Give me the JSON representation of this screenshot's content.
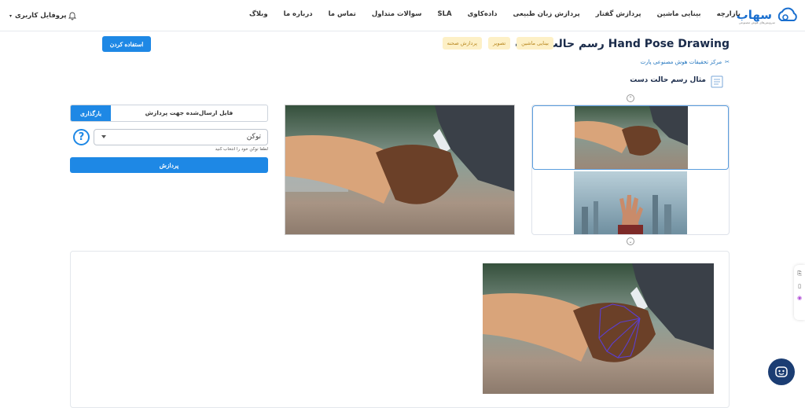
{
  "header": {
    "logo_text": "سهاب",
    "logo_tagline": "سرویس‌های هوش مصنوعی",
    "nav": [
      "بازارچه",
      "بینایی ماشین",
      "پردازش گفتار",
      "پردازش زبان طبیعی",
      "داده‌کاوی",
      "SLA",
      "سوالات متداول",
      "تماس ما",
      "درباره ما",
      "وبلاگ"
    ],
    "profile_label": "پروفایل کاربری"
  },
  "page": {
    "title": "رسم حالت دست Hand Pose Drawing",
    "chips": [
      "بینایی ماشین",
      "تصویر",
      "پردازش صحنه"
    ],
    "use_button": "استفاده کردن",
    "center_link": "مرکز تحقیقات هوش مصنوعی پارت",
    "example_title": "مثال رسم حالت دست"
  },
  "form": {
    "upload_button": "بارگذاری",
    "upload_label": "فایل ارسال‌شده جهت پردازش",
    "help_symbol": "?",
    "token_value": "توکن",
    "token_hint": "لطفا توکن خود را انتخاب کنید",
    "process_button": "پردازش"
  },
  "gallery": {
    "up_arrow": "⌃",
    "down_arrow": "⌄"
  },
  "icons": {
    "bell": "bell-icon",
    "chat": "chat-bot-icon",
    "doc": "document-icon",
    "link": "link-icon"
  },
  "colors": {
    "primary": "#1e88e5",
    "title": "#1a2b4a",
    "chip_bg": "#fdf0c6",
    "chip_text": "#b8871f",
    "fab": "#1b3d73"
  }
}
